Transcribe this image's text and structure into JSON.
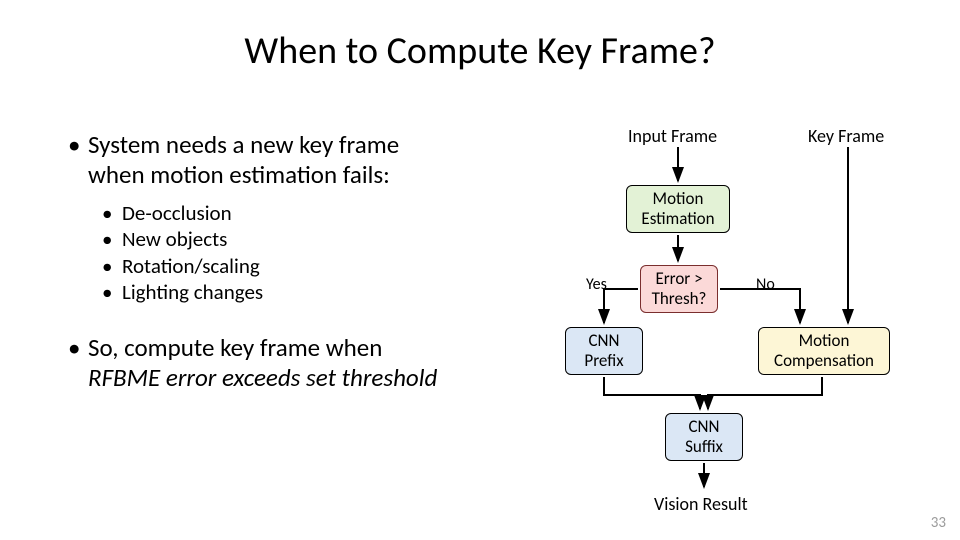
{
  "title": "When to Compute Key Frame?",
  "bullets": {
    "main1a": "System needs a new key frame",
    "main1b": "when motion estimation fails:",
    "subs": [
      "De-occlusion",
      "New objects",
      "Rotation/scaling",
      "Lighting changes"
    ],
    "main2a": "So, compute key frame when",
    "main2b": "RFBME error exceeds set threshold"
  },
  "diagram": {
    "input_frame": "Input Frame",
    "key_frame": "Key Frame",
    "motion_estimation": "Motion\nEstimation",
    "error_thresh": "Error >\nThresh?",
    "yes": "Yes",
    "no": "No",
    "cnn_prefix": "CNN\nPrefix",
    "motion_comp": "Motion\nCompensation",
    "cnn_suffix": "CNN\nSuffix",
    "vision_result": "Vision Result"
  },
  "page_number": "33"
}
